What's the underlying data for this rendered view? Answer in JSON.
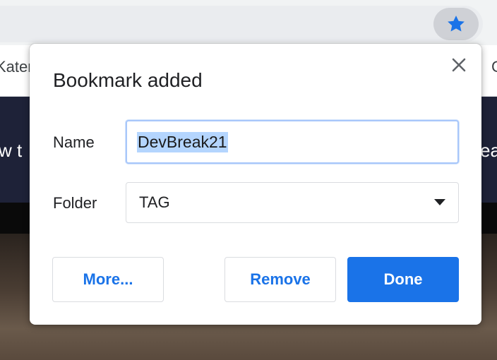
{
  "browser": {
    "bookmarks_bar_left_text": "Kater",
    "bookmarks_bar_right_text": "C",
    "banner_left_text": "w t",
    "banner_right_text": "ea",
    "star_color": "#1a73e8",
    "star_icon": "star-icon"
  },
  "dialog": {
    "title": "Bookmark added",
    "close_icon": "close-icon",
    "name_label": "Name",
    "name_value": "DevBreak21",
    "folder_label": "Folder",
    "folder_value": "TAG",
    "dropdown_icon": "caret-down-icon",
    "buttons": {
      "more": "More...",
      "remove": "Remove",
      "done": "Done"
    },
    "accent_color": "#1a73e8"
  }
}
